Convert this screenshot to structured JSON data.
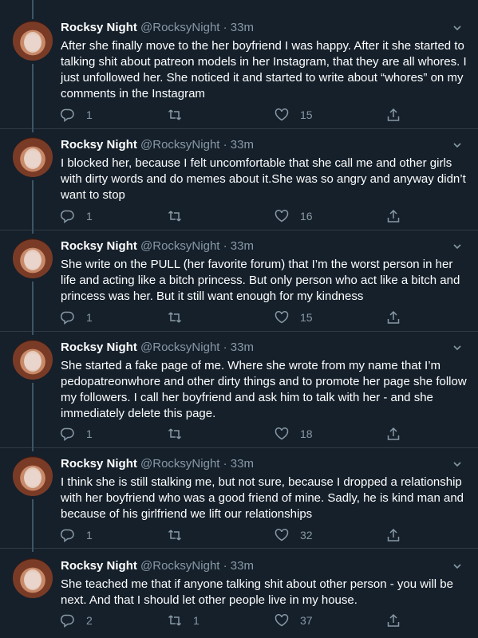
{
  "tweets": [
    {
      "name": "Rocksy Night",
      "handle": "@RocksyNight · 33m",
      "text": "After she finally move to the her boyfriend I was happy. After it she started to talking shit about patreon models in her Instagram, that they are all whores. I just unfollowed her. She noticed it and started to write about “whores” on my comments in the Instagram",
      "replies": "1",
      "retweets": "",
      "likes": "15"
    },
    {
      "name": "Rocksy Night",
      "handle": "@RocksyNight · 33m",
      "text": "I blocked her, because I felt uncomfortable that she call me and other girls with dirty words and do memes about it.She was so angry and anyway didn’t want to stop",
      "replies": "1",
      "retweets": "",
      "likes": "16"
    },
    {
      "name": "Rocksy Night",
      "handle": "@RocksyNight · 33m",
      "text": "She write on the PULL (her favorite forum) that I’m the worst person in her life and acting like a bitch princess. But only person who act like a bitch and princess was her. But it still want enough for my kindness",
      "replies": "1",
      "retweets": "",
      "likes": "15"
    },
    {
      "name": "Rocksy Night",
      "handle": "@RocksyNight · 33m",
      "text": "She started a fake page of me. Where she wrote from my name that I’m pedopatreonwhore and other dirty things and to promote her page she follow my followers. I call her boyfriend and ask him to talk with her - and she immediately delete this page.",
      "replies": "1",
      "retweets": "",
      "likes": "18"
    },
    {
      "name": "Rocksy Night",
      "handle": "@RocksyNight · 33m",
      "text": "I think she is still stalking me, but not sure, because I dropped a relationship with her boyfriend who was a good friend of mine. Sadly, he is kind man and because of his girlfriend we lift our relationships",
      "replies": "1",
      "retweets": "",
      "likes": "32"
    },
    {
      "name": "Rocksy Night",
      "handle": "@RocksyNight · 33m",
      "text": "She teached me that if anyone talking shit about other person - you will be next. And that I should let other people live in my house.",
      "replies": "2",
      "retweets": "1",
      "likes": "37"
    }
  ],
  "icons": {
    "reply": "reply-icon",
    "retweet": "retweet-icon",
    "like": "heart-icon",
    "share": "share-icon",
    "caret": "chevron-down-icon"
  },
  "colors": {
    "background": "#15202b",
    "text": "#ffffff",
    "secondary": "#8899a6",
    "thread_line": "#3d5466"
  }
}
